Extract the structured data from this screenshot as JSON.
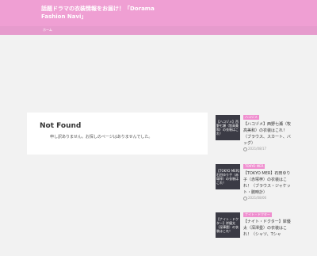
{
  "site": {
    "title": "話題ドラマの衣装情報をお届け！「Dorama Fashion Navi」",
    "nav_home": "ホーム"
  },
  "main": {
    "heading": "Not Found",
    "message": "申し訳ありません。お探しのページはありませんでした。"
  },
  "sidebar": {
    "cards": [
      {
        "thumb_text": "【ハコヅメ】西野七瀬（牧高美和）の衣装はこれ！",
        "category": "ハコヅメ",
        "title": "【ハコヅメ】西野七瀬（牧高美和）の衣装はこれ！（ブラウス、スカート、バッグ）",
        "date": "2021/08/17"
      },
      {
        "thumb_text": "【TOKYO MER】石田ゆり子（赤塚梓）の衣装はこれ！",
        "category": "TOKYO MER",
        "title": "【TOKYO MER】石田ゆり子（赤塚梓）の衣装はこれ！（ブラウス・ジャケット・腕時計）",
        "date": "2021/08/06"
      },
      {
        "thumb_text": "【ナイト・ドクター】岸優太（深澤塁）の衣装はこれ！",
        "category": "ナイト・ドクター",
        "title": "【ナイト・ドクター】岸優太（深澤塁）の衣装はこれ！（シャツ、Tシャ",
        "date": ""
      }
    ]
  },
  "colors": {
    "header": "#ef9fd3",
    "navbar": "#e69bcd",
    "badge": "#ef8fcf",
    "page_bg": "#f2f2f2"
  }
}
